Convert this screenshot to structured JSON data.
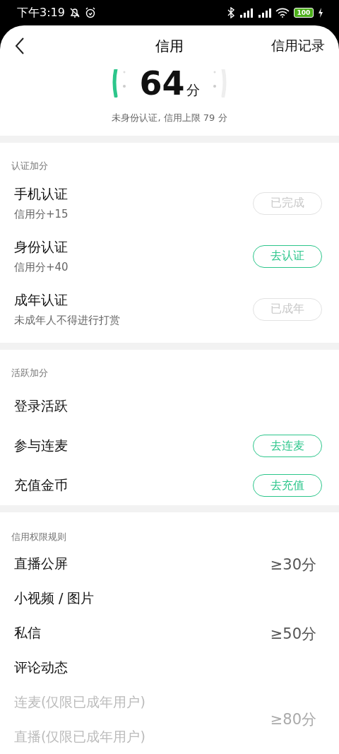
{
  "status_bar": {
    "time": "下午3:19",
    "battery": "100"
  },
  "header": {
    "title": "信用",
    "action": "信用记录"
  },
  "score": {
    "value": "64",
    "unit": "分",
    "note": "未身份认证, 信用上限 79 分"
  },
  "cert_section": {
    "title": "认证加分",
    "items": [
      {
        "title": "手机认证",
        "subtitle": "信用分+15",
        "button": {
          "label": "已完成",
          "disabled": true
        }
      },
      {
        "title": "身份认证",
        "subtitle": "信用分+40",
        "button": {
          "label": "去认证",
          "disabled": false
        }
      },
      {
        "title": "成年认证",
        "subtitle": "未成年人不得进行打赏",
        "button": {
          "label": "已成年",
          "disabled": true
        }
      }
    ]
  },
  "active_section": {
    "title": "活跃加分",
    "items": [
      {
        "title": "登录活跃"
      },
      {
        "title": "参与连麦",
        "button": {
          "label": "去连麦",
          "disabled": false
        }
      },
      {
        "title": "充值金币",
        "button": {
          "label": "去充值",
          "disabled": false
        }
      }
    ]
  },
  "rules_section": {
    "title": "信用权限规则",
    "groups": [
      {
        "labels": [
          "直播公屏",
          "小视频 / 图片"
        ],
        "value": "≥30分",
        "disabled": false
      },
      {
        "labels": [
          "私信",
          "评论动态"
        ],
        "value": "≥50分",
        "disabled": false
      },
      {
        "labels": [
          "连麦(仅限已成年用户)",
          "直播(仅限已成年用户)"
        ],
        "value": "≥80分",
        "disabled": true
      }
    ]
  }
}
